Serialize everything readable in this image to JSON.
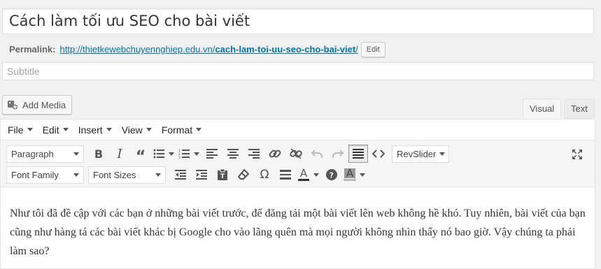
{
  "post": {
    "title": "Cách làm tối ưu SEO cho bài viết",
    "permalink_label": "Permalink:",
    "permalink_base": "http://thietkewebchuyennghiep.edu.vn/",
    "permalink_slug": "cach-lam-toi-uu-seo-cho-bai-viet",
    "permalink_end": "/",
    "edit_label": "Edit",
    "subtitle_placeholder": "Subtitle"
  },
  "media": {
    "add_media_label": "Add Media"
  },
  "tabs": {
    "visual": "Visual",
    "text": "Text"
  },
  "menubar": [
    "File",
    "Edit",
    "Insert",
    "View",
    "Format"
  ],
  "toolbar": {
    "paragraph": "Paragraph",
    "revslider": "RevSlider",
    "font_family": "Font Family",
    "font_sizes": "Font Sizes",
    "text_color_letter": "A",
    "bg_color_letter": "A"
  },
  "icons": {
    "toolbar1": [
      "bold-icon",
      "italic-icon",
      "blockquote-icon",
      "bullet-list-icon",
      "numbered-list-icon",
      "align-left-icon",
      "align-center-icon",
      "align-right-icon",
      "link-icon",
      "unlink-icon",
      "undo-icon",
      "redo-icon",
      "toolbar-toggle-icon",
      "code-icon",
      "fullscreen-icon"
    ],
    "toolbar2": [
      "outdent-icon",
      "indent-icon",
      "paste-text-icon",
      "clear-format-icon",
      "special-char-icon",
      "horizontal-line-icon",
      "text-color-icon",
      "help-icon",
      "background-color-icon"
    ]
  },
  "colors": {
    "link": "#0073aa",
    "active_button_bg": "#ebebeb"
  },
  "content": {
    "paragraph_1": "Như tôi đã đề cập với các bạn ở những bài viết trước, để đăng tải một bài viết lên web không hề khó. Tuy nhiên, bài viết của bạn cũng như hàng tá các bài viết khác bị Google cho vào lãng quên mà mọi người không nhìn thấy nó bao giờ.  Vậy chúng ta phải làm sao?"
  }
}
